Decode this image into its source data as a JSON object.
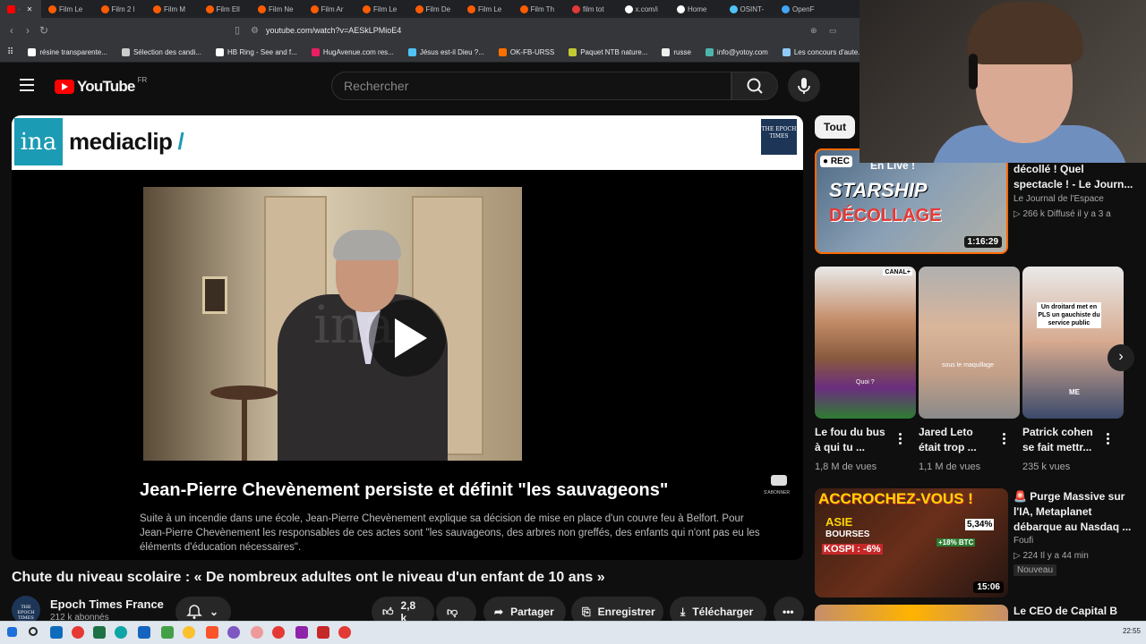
{
  "browser": {
    "tabs": [
      "Film Le",
      "Film 2 l",
      "Film M",
      "Film Ell",
      "Film Ne",
      "Film Ar",
      "Film Le",
      "Film De",
      "Film Le",
      "Film Th",
      "film tot",
      "x.com/i",
      "Home",
      "OSINT-",
      "OpenF"
    ],
    "tab_colors": [
      "#ff5c00",
      "#ff5c00",
      "#ff5c00",
      "#ff5c00",
      "#ff5c00",
      "#ff5c00",
      "#ff5c00",
      "#ff5c00",
      "#ff5c00",
      "#ff5c00",
      "#e53935",
      "#ffffff",
      "#ffffff",
      "#4fc3f7",
      "#42a5f5"
    ],
    "active_tab_close": "✕",
    "url": "youtube.com/watch?v=AESkLPMioE4",
    "bookmarks": [
      "résine transparente...",
      "Sélection des candi...",
      "HB Ring - See and f...",
      "HugAvenue.com res...",
      "Jésus est-il Dieu ?...",
      "OK-FB-URSS",
      "Paquet NTB nature...",
      "russe",
      "info@yotoy.com",
      "Les concours d'aute..."
    ],
    "bookmark_colors": [
      "#ffffff",
      "#cccccc",
      "#ffffff",
      "#e91e63",
      "#4fc3f7",
      "#ff6f00",
      "#c0ca33",
      "#eeeeee",
      "#4db6ac",
      "#90caf9"
    ]
  },
  "youtube": {
    "logo_text": "YouTube",
    "country": "FR",
    "search_placeholder": "Rechercher"
  },
  "player": {
    "ina_logo": "ina",
    "mediaclip": "mediaclip",
    "mediaclip_slash": "/",
    "epoch_badge": "THE EPOCH TIMES",
    "subscribe_small": "S'ABONNER",
    "title": "Jean-Pierre Chevènement persiste et définit \"les sauvageons\"",
    "description": "Suite à un incendie dans une école, Jean-Pierre Chevènement explique sa décision de mise en place d'un couvre feu à Belfort. Pour Jean-Pierre Chevènement les responsables de ces actes sont \"les sauvageons, des arbres non greffés, des enfants qui n'ont pas eu les éléments d'éducation nécessaires\".",
    "watermark": "ina"
  },
  "video": {
    "title": "Chute du niveau scolaire : « De nombreux adultes ont le niveau d'un enfant de 10 ans »",
    "channel": "Epoch Times France",
    "subscribers": "212 k abonnés",
    "likes": "2,8 k",
    "share": "Partager",
    "save": "Enregistrer",
    "download": "Télécharger"
  },
  "sidebar": {
    "chip": "Tout",
    "live_video": {
      "rec": "REC",
      "thumb_text1": "En Live !",
      "thumb_text2": "STARSHIP",
      "thumb_text3": "DÉCOLLAGE",
      "duration": "1:16:29",
      "title": "décollé ! Quel spectacle ! - Le Journ...",
      "channel": "Le Journal de l'Espace",
      "meta": "266 k  Diffusé il y a 3 a"
    },
    "shorts": [
      {
        "title": "Le fou du bus à qui tu ...",
        "views": "1,8 M de vues",
        "tag": "CANAL+",
        "caption": "Quoi ?"
      },
      {
        "title": "Jared Leto était trop ...",
        "views": "1,1 M de vues",
        "caption": "sous le maquillage"
      },
      {
        "title": "Patrick cohen se fait mettr...",
        "views": "235 k vues",
        "caption": "Un droitard met en PLS un gauchiste du service public",
        "tag": "ME"
      }
    ],
    "video3": {
      "thumb_text": "ACCROCHEZ-VOUS !",
      "thumb_asie": "ASIE",
      "thumb_bourses": "BOURSES",
      "thumb_kospi": "KOSPI : -6%",
      "thumb_pct": "5,34%",
      "thumb_btc": "+18% BTC",
      "duration": "15:06",
      "title": "🚨 Purge Massive sur l'IA, Metaplanet débarque au Nasdaq ...",
      "channel": "Foufi",
      "meta": "224  Il y a 44 min",
      "badge": "Nouveau"
    },
    "video4_title": "Le CEO de Capital B"
  },
  "taskbar": {
    "clock": "22:55"
  }
}
